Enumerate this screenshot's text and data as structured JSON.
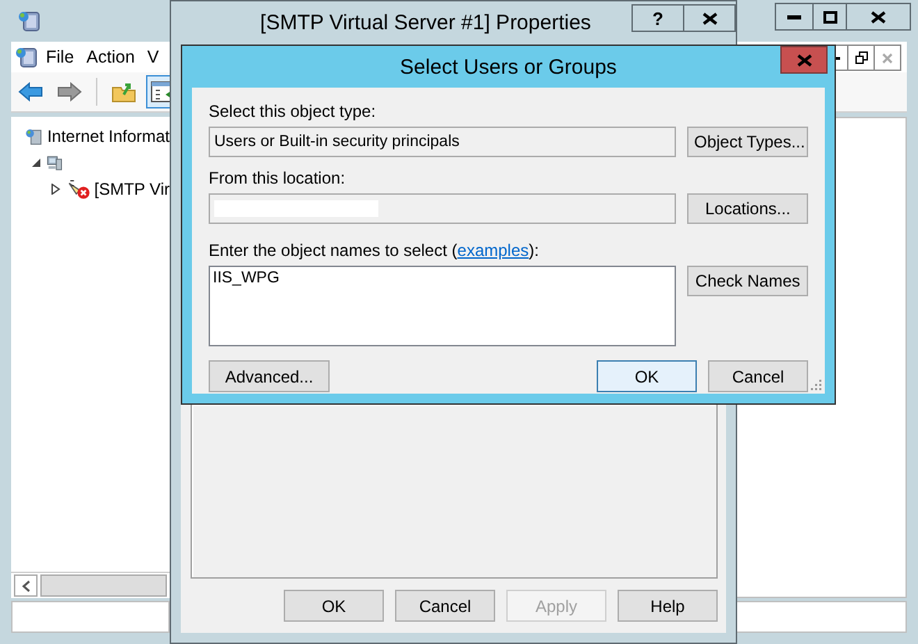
{
  "main_window": {
    "menu": [
      {
        "label": "File"
      },
      {
        "label": "Action"
      },
      {
        "label": "V"
      }
    ],
    "toolbar": [
      {
        "kind": "back",
        "pressed": false
      },
      {
        "kind": "forward",
        "pressed": false
      },
      {
        "kind": "up",
        "pressed": false
      },
      {
        "kind": "console-tree",
        "pressed": true
      }
    ],
    "tree": [
      {
        "kind": "root",
        "label": "Internet Informat",
        "children": [
          {
            "kind": "server",
            "expanded": true,
            "children": [
              {
                "kind": "smtp",
                "label": "[SMTP Vir",
                "expanded": false
              }
            ]
          }
        ]
      }
    ]
  },
  "properties_window": {
    "title": "[SMTP Virtual Server #1] Properties",
    "help": "?",
    "buttons": [
      {
        "label": "OK",
        "disabled": false
      },
      {
        "label": "Cancel",
        "disabled": false
      },
      {
        "label": "Apply",
        "disabled": true
      },
      {
        "label": "Help",
        "disabled": false
      }
    ]
  },
  "select_dialog": {
    "title": "Select Users or Groups",
    "object_type": {
      "label": "Select this object type:",
      "value": "Users or Built-in security principals",
      "button": "Object Types..."
    },
    "location": {
      "label": "From this location:",
      "button": "Locations..."
    },
    "names": {
      "label_before": "Enter the object names to select (",
      "link": "examples",
      "label_after": "):",
      "value": "IIS_WPG",
      "button": "Check Names"
    },
    "buttons": [
      {
        "label": "Advanced...",
        "default": false
      },
      {
        "label": "OK",
        "default": true
      },
      {
        "label": "Cancel",
        "default": false
      }
    ]
  }
}
